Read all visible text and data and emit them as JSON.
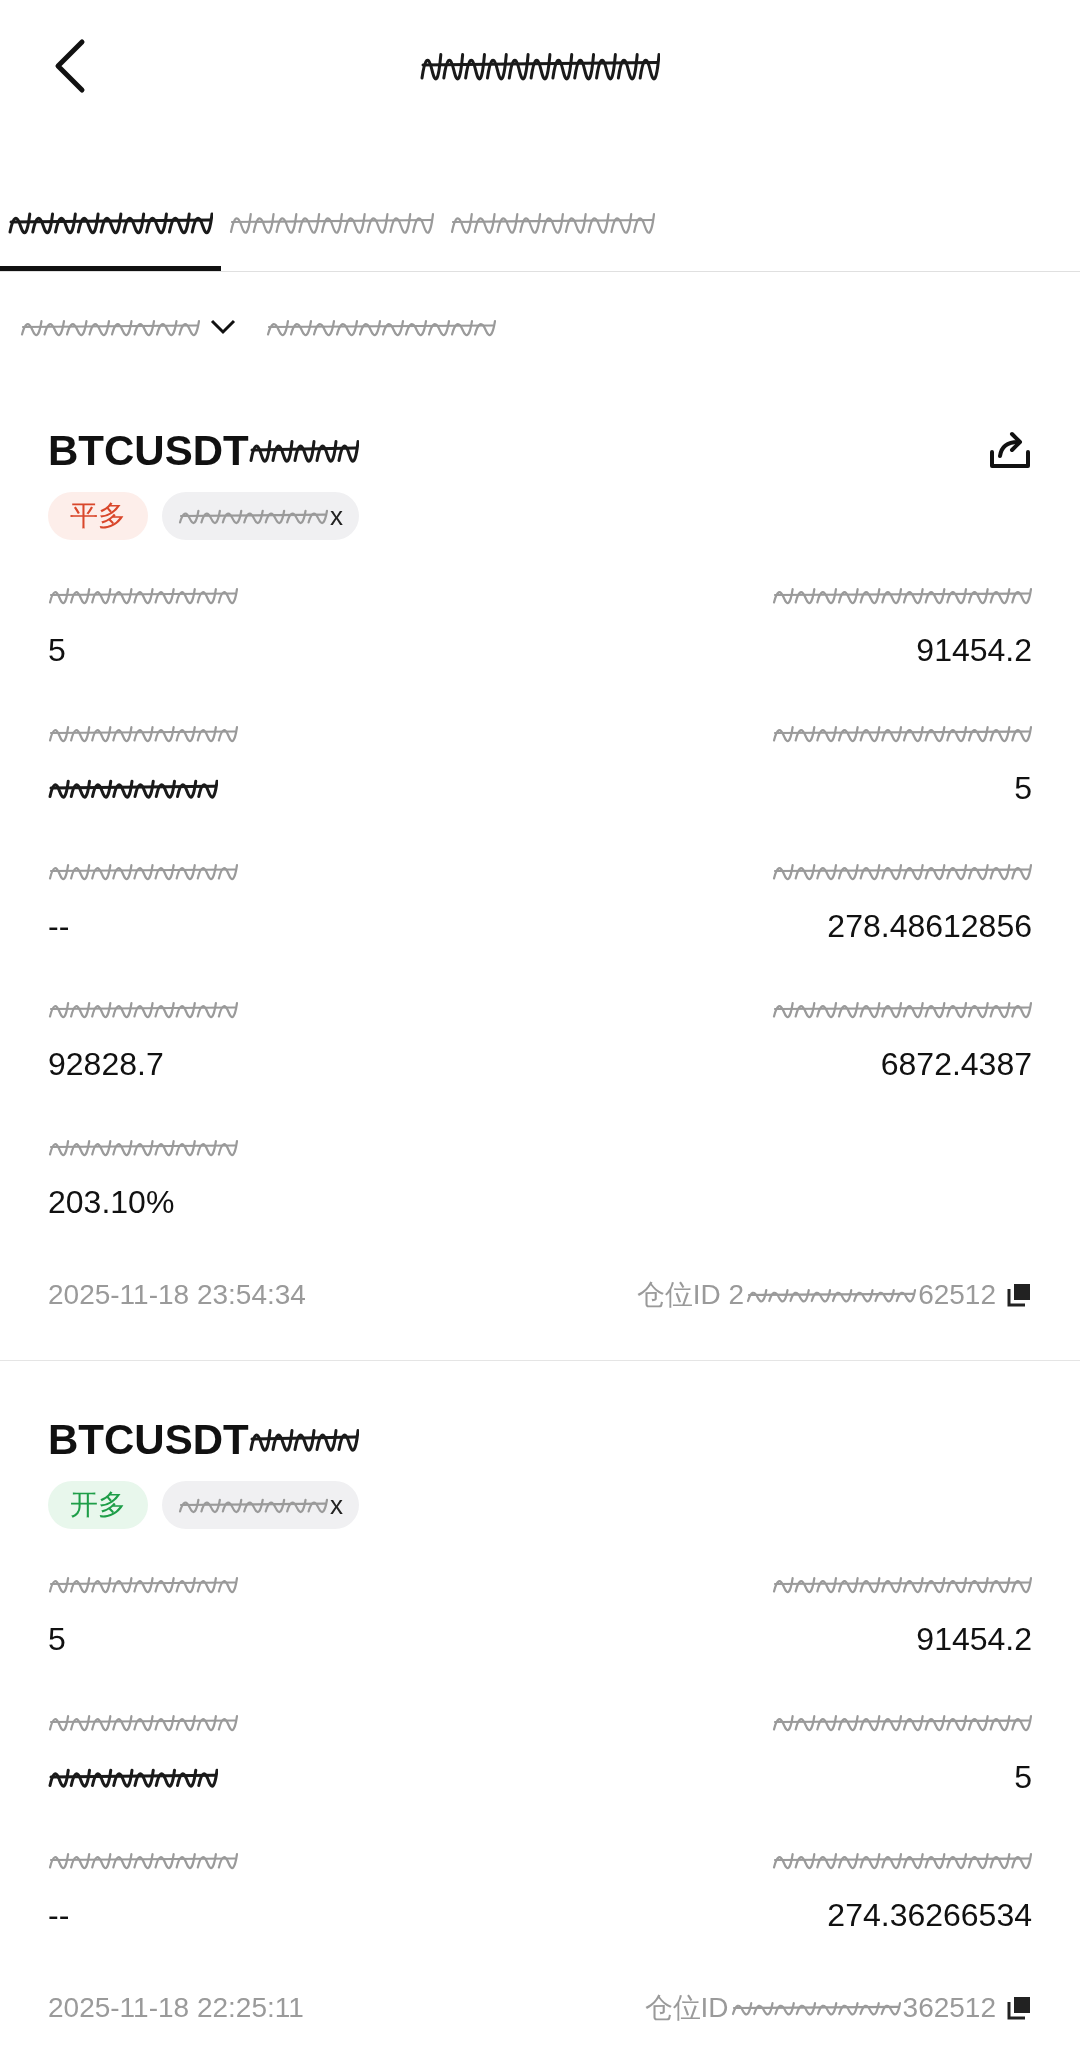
{
  "header": {
    "title": {
      "kind": "redacted"
    }
  },
  "tabs": [
    {
      "kind": "redacted",
      "selected": true
    },
    {
      "kind": "redacted",
      "selected": false
    },
    {
      "kind": "redacted",
      "selected": false
    }
  ],
  "filters": [
    {
      "kind": "redacted",
      "dropdown": true
    },
    {
      "kind": "redacted",
      "dropdown": false
    }
  ],
  "positions": [
    {
      "symbol": "BTCUSDT",
      "symbol_suffix": {
        "kind": "redacted"
      },
      "shareable": true,
      "side": {
        "label": "平多",
        "kind": "close"
      },
      "leverage": "x",
      "fields": [
        {
          "left": {
            "label": {
              "kind": "redacted"
            },
            "value": "5"
          },
          "right": {
            "label": {
              "kind": "redacted"
            },
            "value": "91454.2"
          }
        },
        {
          "left": {
            "label": {
              "kind": "redacted"
            },
            "value": {
              "kind": "redacted"
            }
          },
          "right": {
            "label": {
              "kind": "redacted"
            },
            "value": "5"
          }
        },
        {
          "left": {
            "label": {
              "kind": "redacted"
            },
            "value": "--"
          },
          "right": {
            "label": {
              "kind": "redacted"
            },
            "value": "278.48612856"
          }
        },
        {
          "left": {
            "label": {
              "kind": "redacted"
            },
            "value": "92828.7"
          },
          "right": {
            "label": {
              "kind": "redacted"
            },
            "value": "6872.4387"
          }
        },
        {
          "left": {
            "label": {
              "kind": "redacted"
            },
            "value": "203.10%"
          }
        }
      ],
      "time": "2025-11-18 23:54:34",
      "id_prefix": "仓位ID 2",
      "id_suffix": "62512"
    },
    {
      "symbol": "BTCUSDT",
      "symbol_suffix": {
        "kind": "redacted"
      },
      "shareable": false,
      "side": {
        "label": "开多",
        "kind": "open"
      },
      "leverage": "x",
      "fields": [
        {
          "left": {
            "label": {
              "kind": "redacted"
            },
            "value": "5"
          },
          "right": {
            "label": {
              "kind": "redacted"
            },
            "value": "91454.2"
          }
        },
        {
          "left": {
            "label": {
              "kind": "redacted"
            },
            "value": {
              "kind": "redacted"
            }
          },
          "right": {
            "label": {
              "kind": "redacted"
            },
            "value": "5"
          }
        },
        {
          "left": {
            "label": {
              "kind": "redacted"
            },
            "value": "--"
          },
          "right": {
            "label": {
              "kind": "redacted"
            },
            "value": "274.36266534"
          }
        }
      ],
      "time": "2025-11-18 22:25:11",
      "id_prefix": "仓位ID",
      "id_suffix": "362512"
    }
  ]
}
